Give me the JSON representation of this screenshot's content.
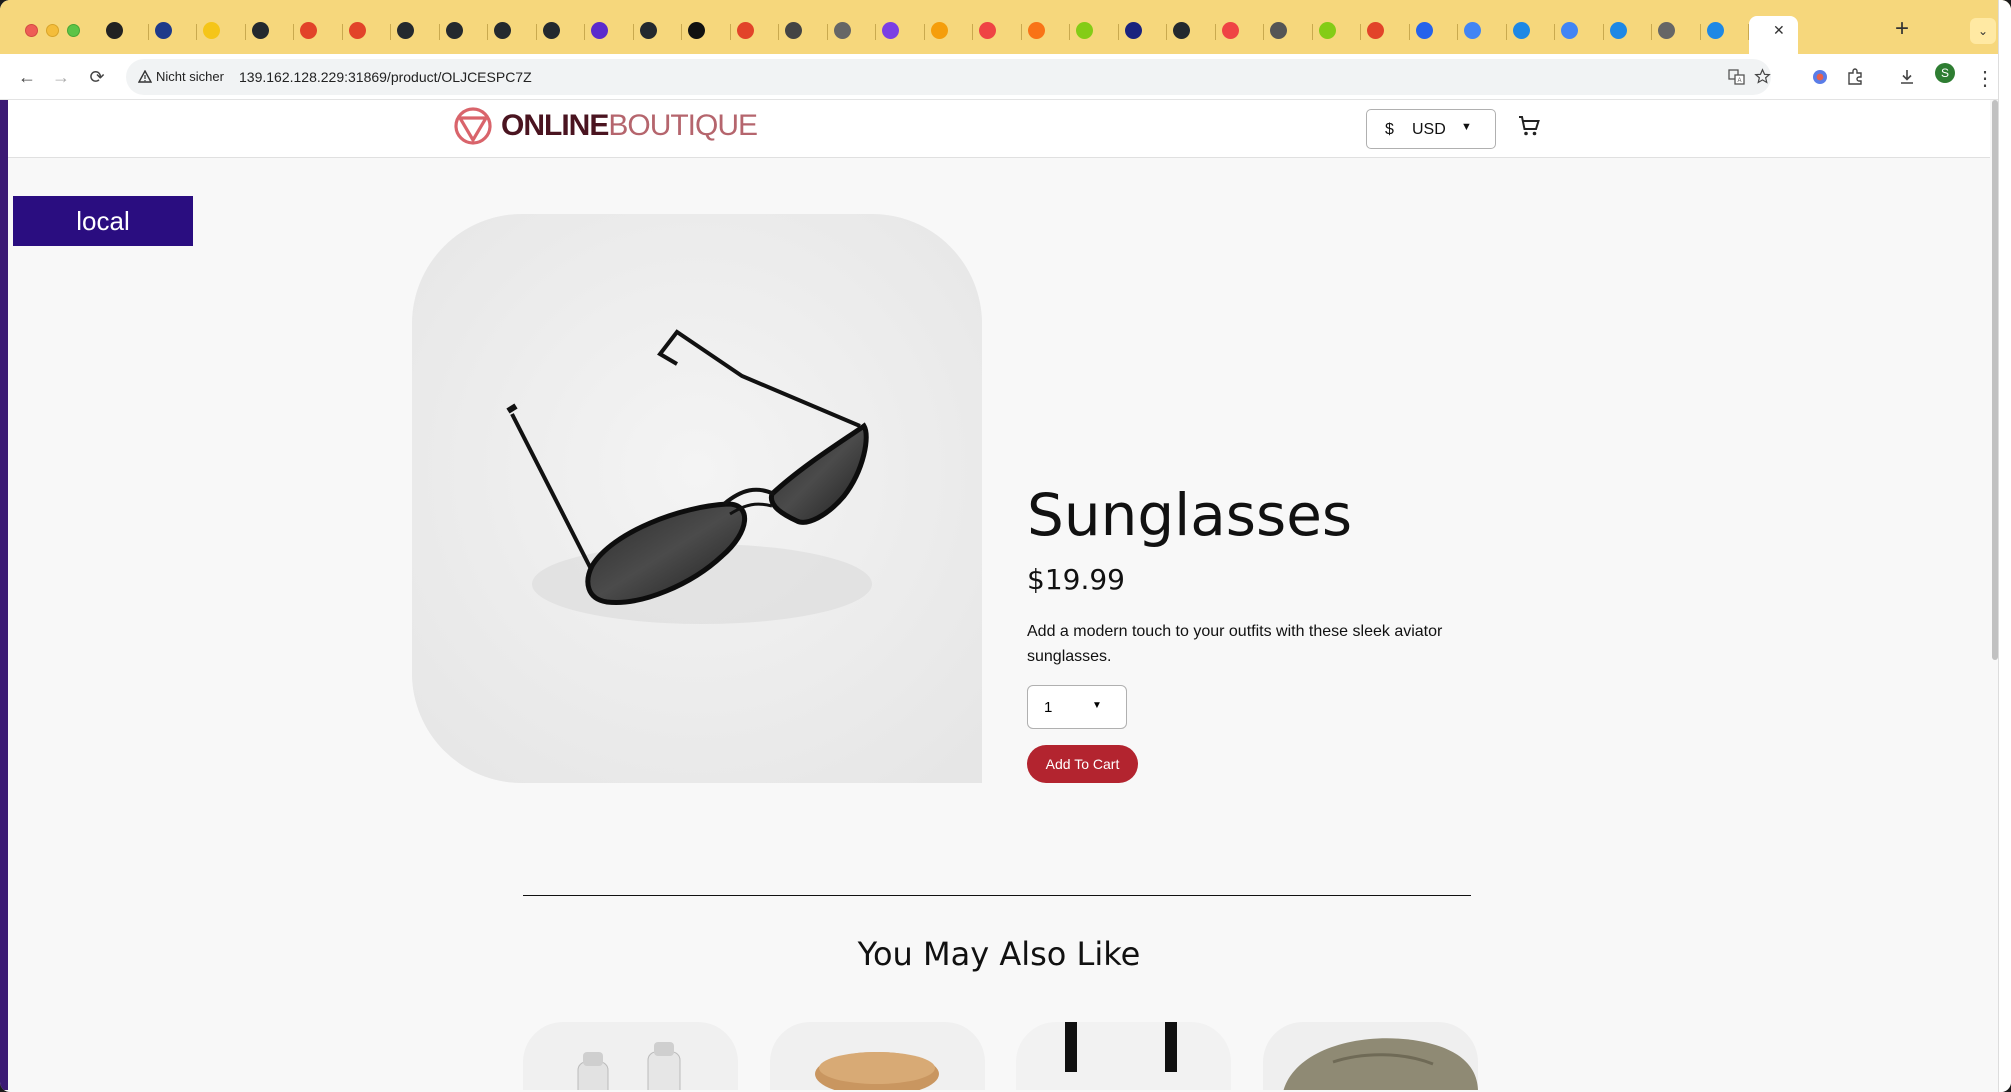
{
  "browser": {
    "tabs_row": [
      {
        "color": "#222222"
      },
      {
        "color": "#1e3a8a"
      },
      {
        "color": "#f5c518"
      },
      {
        "color": "#24292e"
      },
      {
        "color": "#e24329"
      },
      {
        "color": "#e24329"
      },
      {
        "color": "#24292e"
      },
      {
        "color": "#24292e"
      },
      {
        "color": "#24292e"
      },
      {
        "color": "#24292e"
      },
      {
        "color": "#5b2bcc"
      },
      {
        "color": "#24292e"
      },
      {
        "color": "#111111"
      },
      {
        "color": "#e24329"
      },
      {
        "color": "#444444"
      },
      {
        "color": "#666666"
      },
      {
        "color": "#7b3fe4"
      },
      {
        "color": "#f59e0b"
      },
      {
        "color": "#ef4444"
      },
      {
        "color": "#f97316"
      },
      {
        "color": "#84cc16"
      },
      {
        "color": "#1a237e"
      },
      {
        "color": "#24292e"
      },
      {
        "color": "#ef4444"
      },
      {
        "color": "#555555"
      },
      {
        "color": "#84cc16"
      },
      {
        "color": "#e24329"
      },
      {
        "color": "#2563eb"
      },
      {
        "color": "#4285f4"
      },
      {
        "color": "#1e88e5"
      },
      {
        "color": "#4285f4"
      },
      {
        "color": "#1e88e5"
      },
      {
        "color": "#666666"
      },
      {
        "color": "#1e88e5"
      }
    ],
    "active_tab_close": "✕",
    "new_tab": "+",
    "tab_search": "⌄",
    "toolbar": {
      "back": "←",
      "forward": "→",
      "reload": "⟳",
      "insecure_label": "Nicht sicher",
      "url": "139.162.128.229:31869/product/OLJCESPC7Z",
      "profile_initial": "S"
    }
  },
  "site": {
    "logo": {
      "online": "ONLINE",
      "boutique": "BOUTIQUE"
    },
    "currency": {
      "symbol": "$",
      "code": "USD"
    },
    "env_badge": "local"
  },
  "product": {
    "name": "Sunglasses",
    "price": "$19.99",
    "description": "Add a modern touch to your outfits with these sleek aviator sunglasses.",
    "quantity": "1",
    "add_to_cart": "Add To Cart"
  },
  "recommendations": {
    "title": "You May Also Like",
    "items": [
      {
        "icon": "salt-pepper-shakers"
      },
      {
        "icon": "bamboo-glass-jar"
      },
      {
        "icon": "tote-bag"
      },
      {
        "icon": "loafers"
      }
    ]
  }
}
